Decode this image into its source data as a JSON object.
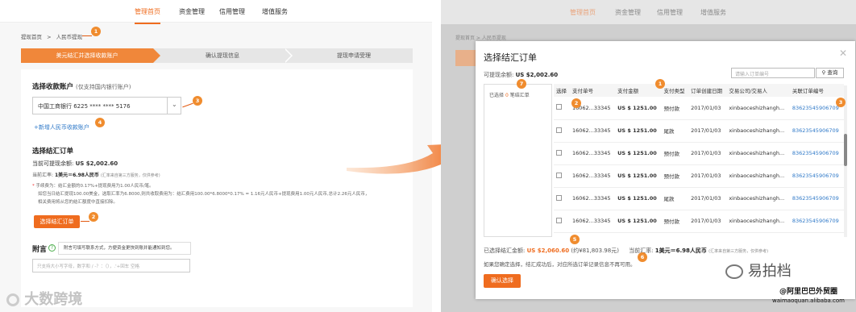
{
  "nav": {
    "items": [
      "管理首页",
      "资金管理",
      "信用管理",
      "增值服务"
    ]
  },
  "breadcrumb": {
    "home": "提现首页",
    "sep": ">",
    "current": "人民币提现"
  },
  "steps": [
    "美元结汇并选择收款账户",
    "确认提现信息",
    "提现申请受理"
  ],
  "account": {
    "title": "选择收款账户",
    "subtitle": "(仅支持国内银行账户)",
    "selected": "中国工商银行   6225 **** **** 5176",
    "add_link": "+新增人民币收款账户"
  },
  "order": {
    "title": "选择结汇订单",
    "balance_label": "当前可提现余额:",
    "balance": "US $2,002.60",
    "rate_label": "当前汇率:",
    "rate": "1美元＝6.98人民币",
    "rate_note": "(汇率来自第三方服务，仅供参考)",
    "fee1": "手续费为：结汇金额的0.17%+提现费用为1.00人民币/笔。",
    "fee2": "如您当日结汇提现100.00美金，选取汇率为6.8000,则共收取费用为：结汇费用100.00*6.8000*0.17% = 1.16元人民币+提现费用1.00元人民币,总计2.26元人民币，",
    "fee3": "相关费用将从您的结汇额度中直接扣除。",
    "button": "选择结汇订单"
  },
  "note": {
    "title": "附言",
    "help": "?",
    "tooltip": "附言可填写联系方式，方便资金更快到账并能通知到您。",
    "placeholder": "只支持大小写字母，数字和 / -？：（），.'+回车 空格"
  },
  "annotations": [
    "1",
    "2",
    "3",
    "4",
    "5",
    "6",
    "7"
  ],
  "dialog": {
    "title": "选择结汇订单",
    "close": "✕",
    "balance_label": "可提现余额:",
    "balance": "US $2,002.60",
    "search_placeholder": "请输入订单编号",
    "search_button": "查询",
    "selected_prefix": "已选择",
    "selected_count": "0",
    "selected_suffix": "笔结汇单",
    "columns": [
      "选择",
      "支付单号",
      "支付金额",
      "支付类型",
      "订单创建日期",
      "交易公司/交易人",
      "关联订单编号"
    ],
    "rows": [
      {
        "pay_no": "16062...33345",
        "amount": "US $ 1251.00",
        "type": "预付款",
        "date": "2017/01/03",
        "party": "xinbaoceshizhangh...",
        "order": "83623545906709"
      },
      {
        "pay_no": "16062...33345",
        "amount": "US $ 1251.00",
        "type": "尾款",
        "date": "2017/01/03",
        "party": "xinbaoceshizhangh...",
        "order": "83623545906709"
      },
      {
        "pay_no": "16062...33345",
        "amount": "US $ 1251.00",
        "type": "预付款",
        "date": "2017/01/03",
        "party": "xinbaoceshizhangh...",
        "order": "83623545906709"
      },
      {
        "pay_no": "16062...33345",
        "amount": "US $ 1251.00",
        "type": "预付款",
        "date": "2017/01/03",
        "party": "xinbaoceshizhangh...",
        "order": "83623545906709"
      },
      {
        "pay_no": "16062...33345",
        "amount": "US $ 1251.00",
        "type": "尾款",
        "date": "2017/01/03",
        "party": "xinbaoceshizhangh...",
        "order": "83623545906709"
      },
      {
        "pay_no": "16062...33345",
        "amount": "US $ 1251.00",
        "type": "预付款",
        "date": "2017/01/03",
        "party": "xinbaoceshizhangh...",
        "order": "83623545906709"
      }
    ],
    "footer_label": "已选择结汇金额:",
    "footer_amount": "US $2,060.60",
    "footer_cny": "(约¥81,803.98元)",
    "footer_rate_label": "当前汇率:",
    "footer_rate": "1美元＝6.98人民币",
    "footer_rate_note": "(汇率来自第三方服务，仅供参考)",
    "footer_note": "如果您确定选择，结汇成功后，对应所选订单记录信息不再可用。",
    "confirm": "确认选择"
  },
  "watermarks": {
    "left": "大数跨境",
    "brand": "易拍档",
    "alibaba": "@阿里巴巴外贸圈",
    "site": "waimaoquan.alibaba.com"
  }
}
